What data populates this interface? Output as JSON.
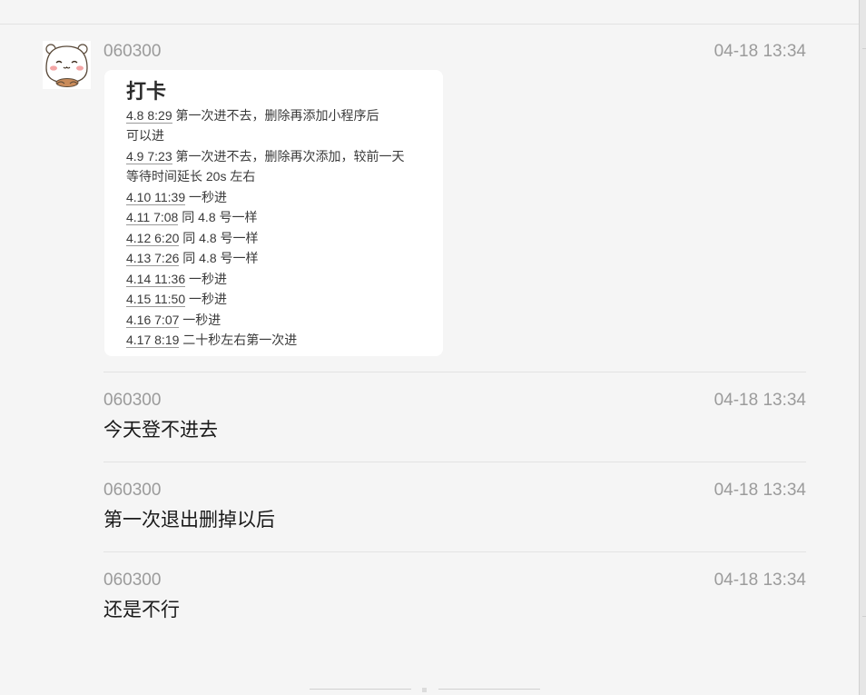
{
  "messages": [
    {
      "sender": "060300",
      "time": "04-18 13:34",
      "image": {
        "title": "打卡",
        "lines": [
          {
            "link": "4.8 8:29",
            "rest": " 第一次进不去，删除再添加小程序后"
          },
          {
            "link": "",
            "rest": "可以进"
          },
          {
            "link": "4.9 7:23",
            "rest": " 第一次进不去，删除再次添加，较前一天"
          },
          {
            "link": "",
            "rest": "等待时间延长 20s 左右"
          },
          {
            "link": "4.10 11:39",
            "rest": " 一秒进"
          },
          {
            "link": "4.11 7:08",
            "rest": " 同 4.8 号一样"
          },
          {
            "link": "4.12 6:20",
            "rest": " 同 4.8 号一样"
          },
          {
            "link": "4.13 7:26",
            "rest": " 同 4.8 号一样"
          },
          {
            "link": "4.14 11:36",
            "rest": " 一秒进"
          },
          {
            "link": "4.15 11:50",
            "rest": " 一秒进"
          },
          {
            "link": "4.16 7:07",
            "rest": " 一秒进"
          },
          {
            "link": "4.17 8:19",
            "rest": " 二十秒左右第一次进"
          }
        ]
      }
    },
    {
      "sender": "060300",
      "time": "04-18 13:34",
      "text": "今天登不进去"
    },
    {
      "sender": "060300",
      "time": "04-18 13:34",
      "text": "第一次退出删掉以后"
    },
    {
      "sender": "060300",
      "time": "04-18 13:34",
      "text": "还是不行"
    }
  ]
}
